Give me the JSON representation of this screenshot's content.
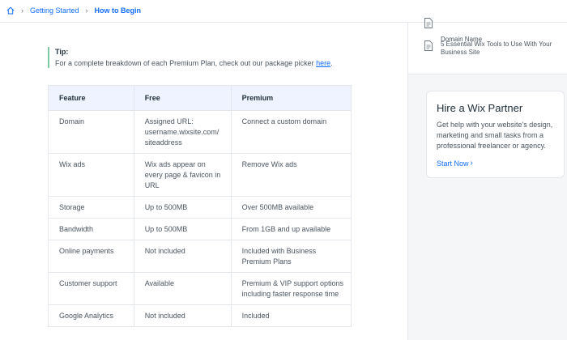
{
  "breadcrumb": {
    "home_icon": "home-icon",
    "items": [
      "Getting Started",
      "How to Begin"
    ]
  },
  "tip": {
    "title": "Tip:",
    "text_before": "For a complete breakdown of each Premium Plan, check out our package picker ",
    "link": "here",
    "text_after": "."
  },
  "table": {
    "headers": [
      "Feature",
      "Free",
      "Premium"
    ],
    "rows": [
      [
        "Domain",
        "Assigned URL: username.wixsite.com/ siteaddress",
        "Connect a custom domain"
      ],
      [
        "Wix ads",
        "Wix ads appear on every page & favicon in URL",
        "Remove Wix ads"
      ],
      [
        "Storage",
        "Up to 500MB",
        "Over 500MB available"
      ],
      [
        "Bandwidth",
        "Up to 500MB",
        "From 1GB and up available"
      ],
      [
        "Online payments",
        "Not included",
        "Included with Business Premium Plans"
      ],
      [
        "Customer support",
        "Available",
        "Premium & VIP support options including faster response time"
      ],
      [
        "Google Analytics",
        "Not included",
        "Included"
      ]
    ]
  },
  "sidebar": {
    "related": [
      {
        "icon": "document-icon",
        "title": "Domain Name"
      },
      {
        "icon": "document-icon",
        "title": "5 Essential Wix Tools to Use With Your Business Site"
      }
    ],
    "partner": {
      "title": "Hire a Wix Partner",
      "text": "Get help with your website's design, marketing and small tasks from a professional freelancer or agency.",
      "link": "Start Now"
    }
  },
  "colors": {
    "link": "#116dff",
    "table_header_bg": "#eef3ff",
    "tip_accent": "#7ec8a4",
    "sidebar_bg": "#f5f6f8"
  }
}
